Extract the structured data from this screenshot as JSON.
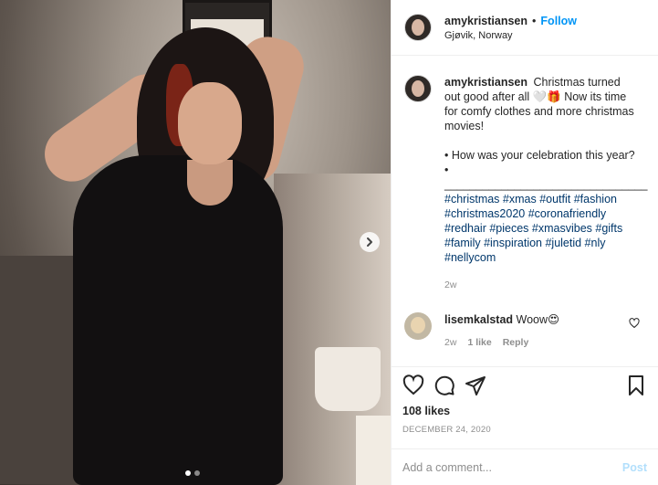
{
  "header": {
    "username": "amykristiansen",
    "separator": "•",
    "follow_label": "Follow",
    "location": "Gjøvik, Norway"
  },
  "caption": {
    "username": "amykristiansen",
    "line1": "Christmas turned out good after all 🤍🎁 Now its time for comfy clothes and more christmas movies!",
    "line2": "• How was your celebration this year?",
    "line3": "•",
    "divider": "________________________________",
    "hashtags": "#christmas #xmas #outfit #fashion #christmas2020 #coronafriendly #redhair #pieces #xmasvibes #gifts #family #inspiration #juletid #nly #nellycom",
    "time": "2w"
  },
  "comment": {
    "username": "lisemkalstad",
    "text": "Woow😍",
    "time": "2w",
    "likes": "1 like",
    "reply_label": "Reply"
  },
  "actions": {
    "likes": "108 likes",
    "date": "DECEMBER 24, 2020"
  },
  "add_comment": {
    "placeholder": "Add a comment...",
    "post_label": "Post"
  },
  "carousel": {
    "current": 1,
    "total": 2
  },
  "icons": [
    "chevron-right-icon",
    "heart-icon",
    "comment-icon",
    "share-icon",
    "bookmark-icon",
    "small-heart-icon"
  ],
  "colors": {
    "accent": "#0095f6",
    "hashtag": "#00376b",
    "muted": "#8e8e8e",
    "post_disabled": "#b2dffc"
  }
}
